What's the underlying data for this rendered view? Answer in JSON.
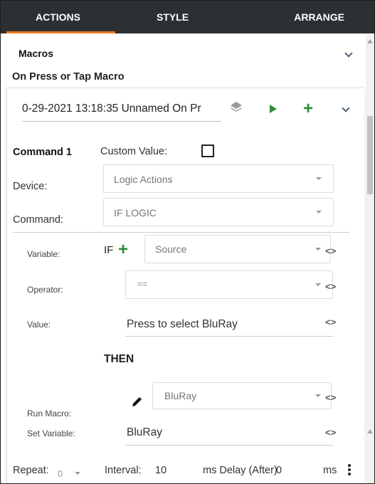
{
  "tabs": [
    {
      "label": "ACTIONS",
      "active": true
    },
    {
      "label": "STYLE",
      "active": false
    },
    {
      "label": "ARRANGE",
      "active": false
    }
  ],
  "accent_color": "#f07b1f",
  "macros": {
    "title": "Macros"
  },
  "section_title": "On Press or Tap Macro",
  "macro": {
    "name": "0-29-2021 13:18:35 Unnamed On Pr",
    "icons": [
      "layers-icon",
      "play-icon",
      "add-icon",
      "chevron-down-icon"
    ]
  },
  "command": {
    "title": "Command 1",
    "custom_value_label": "Custom Value:",
    "custom_value_checked": false,
    "device_label": "Device:",
    "device_value": "Logic Actions",
    "command_label": "Command:",
    "command_value": "IF LOGIC"
  },
  "logic": {
    "variable_label": "Variable:",
    "if_text": "IF",
    "if_plus": "+",
    "variable_value": "Source",
    "operator_label": "Operator:",
    "operator_value": "==",
    "value_label": "Value:",
    "value_text": "Press to select BluRay",
    "then_text": "THEN",
    "run_macro_label": "Run Macro:",
    "run_macro_value": "BluRay",
    "set_variable_label": "Set Variable:",
    "set_variable_value": "BluRay",
    "code_icon_text": "<>"
  },
  "footer": {
    "repeat_label": "Repeat:",
    "repeat_value": "0",
    "interval_label": "Interval:",
    "interval_value": "10",
    "ms_delay_label": "ms Delay (After)",
    "delay_value": "0",
    "ms_label": "ms"
  }
}
